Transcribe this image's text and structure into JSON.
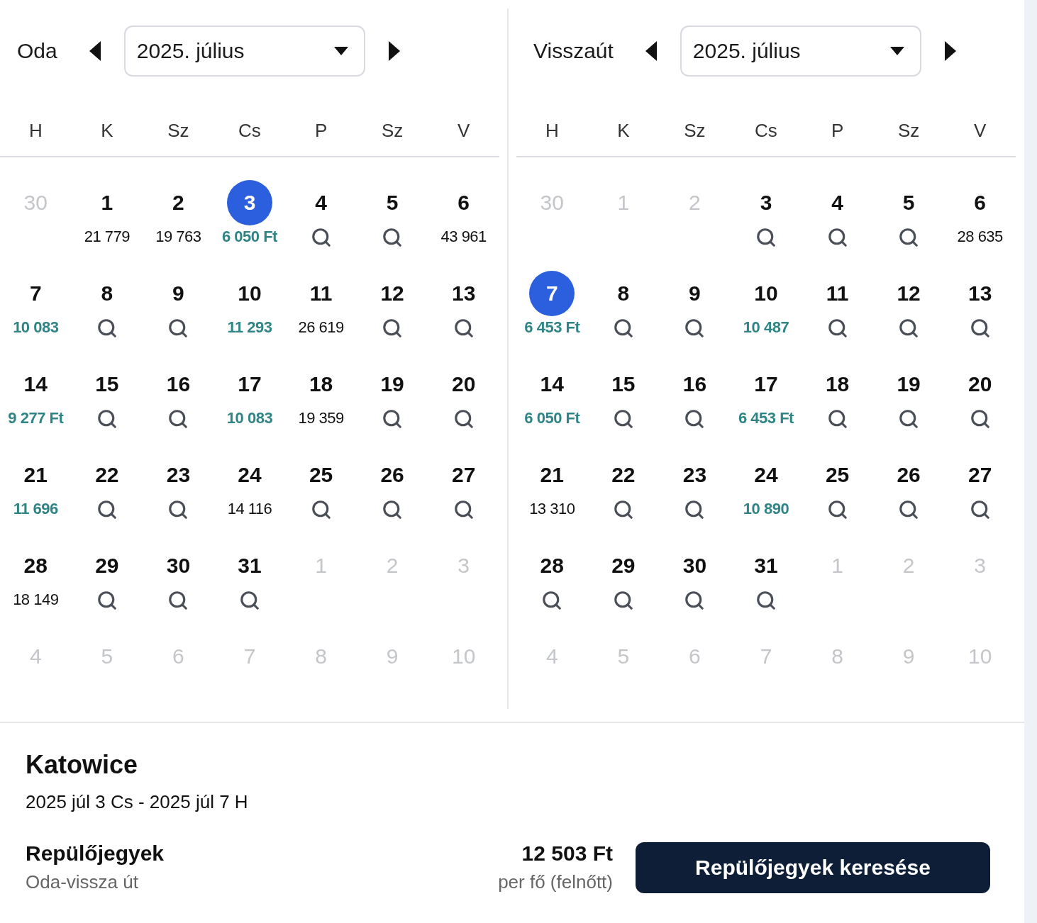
{
  "calendars": [
    {
      "label": "Oda",
      "month": "2025. július",
      "weekdays": [
        "H",
        "K",
        "Sz",
        "Cs",
        "P",
        "Sz",
        "V"
      ],
      "weeks": [
        [
          {
            "day": "30",
            "kind": "muted"
          },
          {
            "day": "1",
            "kind": "price",
            "price": "21 779",
            "selected": false
          },
          {
            "day": "2",
            "kind": "price",
            "price": "19 763",
            "selected": false
          },
          {
            "day": "3",
            "kind": "cheap",
            "price": "6 050 Ft",
            "selected": true
          },
          {
            "day": "4",
            "kind": "search",
            "selected": false
          },
          {
            "day": "5",
            "kind": "search",
            "selected": false
          },
          {
            "day": "6",
            "kind": "price",
            "price": "43 961",
            "selected": false
          }
        ],
        [
          {
            "day": "7",
            "kind": "cheap",
            "price": "10 083",
            "selected": false
          },
          {
            "day": "8",
            "kind": "search",
            "selected": false
          },
          {
            "day": "9",
            "kind": "search",
            "selected": false
          },
          {
            "day": "10",
            "kind": "cheap",
            "price": "11 293",
            "selected": false
          },
          {
            "day": "11",
            "kind": "price",
            "price": "26 619",
            "selected": false
          },
          {
            "day": "12",
            "kind": "search",
            "selected": false
          },
          {
            "day": "13",
            "kind": "search",
            "selected": false
          }
        ],
        [
          {
            "day": "14",
            "kind": "cheap",
            "price": "9 277 Ft",
            "selected": false
          },
          {
            "day": "15",
            "kind": "search",
            "selected": false
          },
          {
            "day": "16",
            "kind": "search",
            "selected": false
          },
          {
            "day": "17",
            "kind": "cheap",
            "price": "10 083",
            "selected": false
          },
          {
            "day": "18",
            "kind": "price",
            "price": "19 359",
            "selected": false
          },
          {
            "day": "19",
            "kind": "search",
            "selected": false
          },
          {
            "day": "20",
            "kind": "search",
            "selected": false
          }
        ],
        [
          {
            "day": "21",
            "kind": "cheap",
            "price": "11 696",
            "selected": false
          },
          {
            "day": "22",
            "kind": "search",
            "selected": false
          },
          {
            "day": "23",
            "kind": "search",
            "selected": false
          },
          {
            "day": "24",
            "kind": "price",
            "price": "14 116",
            "selected": false
          },
          {
            "day": "25",
            "kind": "search",
            "selected": false
          },
          {
            "day": "26",
            "kind": "search",
            "selected": false
          },
          {
            "day": "27",
            "kind": "search",
            "selected": false
          }
        ],
        [
          {
            "day": "28",
            "kind": "price",
            "price": "18 149",
            "selected": false
          },
          {
            "day": "29",
            "kind": "search",
            "selected": false
          },
          {
            "day": "30",
            "kind": "search",
            "selected": false
          },
          {
            "day": "31",
            "kind": "search",
            "selected": false
          },
          {
            "day": "1",
            "kind": "muted"
          },
          {
            "day": "2",
            "kind": "muted"
          },
          {
            "day": "3",
            "kind": "muted"
          }
        ],
        [
          {
            "day": "4",
            "kind": "muted"
          },
          {
            "day": "5",
            "kind": "muted"
          },
          {
            "day": "6",
            "kind": "muted"
          },
          {
            "day": "7",
            "kind": "muted"
          },
          {
            "day": "8",
            "kind": "muted"
          },
          {
            "day": "9",
            "kind": "muted"
          },
          {
            "day": "10",
            "kind": "muted"
          }
        ]
      ]
    },
    {
      "label": "Visszaút",
      "month": "2025. július",
      "weekdays": [
        "H",
        "K",
        "Sz",
        "Cs",
        "P",
        "Sz",
        "V"
      ],
      "weeks": [
        [
          {
            "day": "30",
            "kind": "muted"
          },
          {
            "day": "1",
            "kind": "muted"
          },
          {
            "day": "2",
            "kind": "muted"
          },
          {
            "day": "3",
            "kind": "search",
            "selected": false
          },
          {
            "day": "4",
            "kind": "search",
            "selected": false
          },
          {
            "day": "5",
            "kind": "search",
            "selected": false
          },
          {
            "day": "6",
            "kind": "price",
            "price": "28 635",
            "selected": false
          }
        ],
        [
          {
            "day": "7",
            "kind": "cheap",
            "price": "6 453 Ft",
            "selected": true
          },
          {
            "day": "8",
            "kind": "search",
            "selected": false
          },
          {
            "day": "9",
            "kind": "search",
            "selected": false
          },
          {
            "day": "10",
            "kind": "cheap",
            "price": "10 487",
            "selected": false
          },
          {
            "day": "11",
            "kind": "search",
            "selected": false
          },
          {
            "day": "12",
            "kind": "search",
            "selected": false
          },
          {
            "day": "13",
            "kind": "search",
            "selected": false
          }
        ],
        [
          {
            "day": "14",
            "kind": "cheap",
            "price": "6 050 Ft",
            "selected": false
          },
          {
            "day": "15",
            "kind": "search",
            "selected": false
          },
          {
            "day": "16",
            "kind": "search",
            "selected": false
          },
          {
            "day": "17",
            "kind": "cheap",
            "price": "6 453 Ft",
            "selected": false
          },
          {
            "day": "18",
            "kind": "search",
            "selected": false
          },
          {
            "day": "19",
            "kind": "search",
            "selected": false
          },
          {
            "day": "20",
            "kind": "search",
            "selected": false
          }
        ],
        [
          {
            "day": "21",
            "kind": "price",
            "price": "13 310",
            "selected": false
          },
          {
            "day": "22",
            "kind": "search",
            "selected": false
          },
          {
            "day": "23",
            "kind": "search",
            "selected": false
          },
          {
            "day": "24",
            "kind": "cheap",
            "price": "10 890",
            "selected": false
          },
          {
            "day": "25",
            "kind": "search",
            "selected": false
          },
          {
            "day": "26",
            "kind": "search",
            "selected": false
          },
          {
            "day": "27",
            "kind": "search",
            "selected": false
          }
        ],
        [
          {
            "day": "28",
            "kind": "search",
            "selected": false
          },
          {
            "day": "29",
            "kind": "search",
            "selected": false
          },
          {
            "day": "30",
            "kind": "search",
            "selected": false
          },
          {
            "day": "31",
            "kind": "search",
            "selected": false
          },
          {
            "day": "1",
            "kind": "muted"
          },
          {
            "day": "2",
            "kind": "muted"
          },
          {
            "day": "3",
            "kind": "muted"
          }
        ],
        [
          {
            "day": "4",
            "kind": "muted"
          },
          {
            "day": "5",
            "kind": "muted"
          },
          {
            "day": "6",
            "kind": "muted"
          },
          {
            "day": "7",
            "kind": "muted"
          },
          {
            "day": "8",
            "kind": "muted"
          },
          {
            "day": "9",
            "kind": "muted"
          },
          {
            "day": "10",
            "kind": "muted"
          }
        ]
      ]
    }
  ],
  "summary": {
    "destination": "Katowice",
    "dates": "2025 júl 3 Cs - 2025 júl 7 H",
    "product": "Repülőjegyek",
    "trip_type": "Oda-vissza út",
    "price": "12 503 Ft",
    "price_note": "per fő (felnőtt)",
    "button": "Repülőjegyek keresése"
  }
}
